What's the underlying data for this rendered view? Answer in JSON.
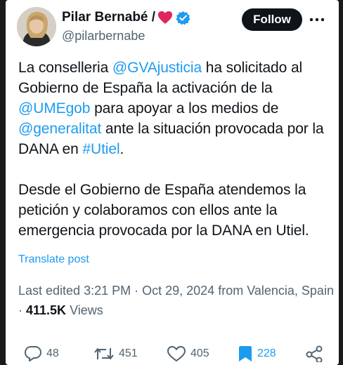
{
  "author": {
    "name": "Pilar Bernabé /",
    "handle": "@pilarbernabe"
  },
  "follow_label": "Follow",
  "tweet": {
    "paragraph1": [
      {
        "text": "La conselleria ",
        "type": "text"
      },
      {
        "text": "@GVAjusticia",
        "type": "mention"
      },
      {
        "text": " ha solicitado al Gobierno de España la activación de la ",
        "type": "text"
      },
      {
        "text": "@UMEgob",
        "type": "mention"
      },
      {
        "text": " para apoyar a los medios de ",
        "type": "text"
      },
      {
        "text": "@generalitat",
        "type": "mention"
      },
      {
        "text": " ante la situación provocada por la DANA en ",
        "type": "text"
      },
      {
        "text": "#Utiel",
        "type": "hashtag"
      },
      {
        "text": ".",
        "type": "text"
      }
    ],
    "paragraph2": "Desde el Gobierno de España atendemos la petición y colaboramos con ellos ante la emergencia provocada por la DANA en Utiel."
  },
  "translate_label": "Translate post",
  "meta": {
    "edited_prefix": "Last edited ",
    "time": "3:21 PM",
    "separator": " · ",
    "date": "Oct 29, 2024",
    "location": " from Valencia, Spain",
    "views_count": "411.5K",
    "views_label": " Views"
  },
  "actions": {
    "replies": "48",
    "reposts": "451",
    "likes": "405",
    "bookmarks": "228"
  },
  "colors": {
    "accent": "#1d9bf0",
    "text": "#0f1419",
    "secondary": "#536471",
    "heart": "#e0245e"
  },
  "icons": [
    "red-heart-icon",
    "verified-badge-icon",
    "more-icon",
    "reply-icon",
    "repost-icon",
    "like-icon",
    "bookmark-icon",
    "share-icon"
  ]
}
